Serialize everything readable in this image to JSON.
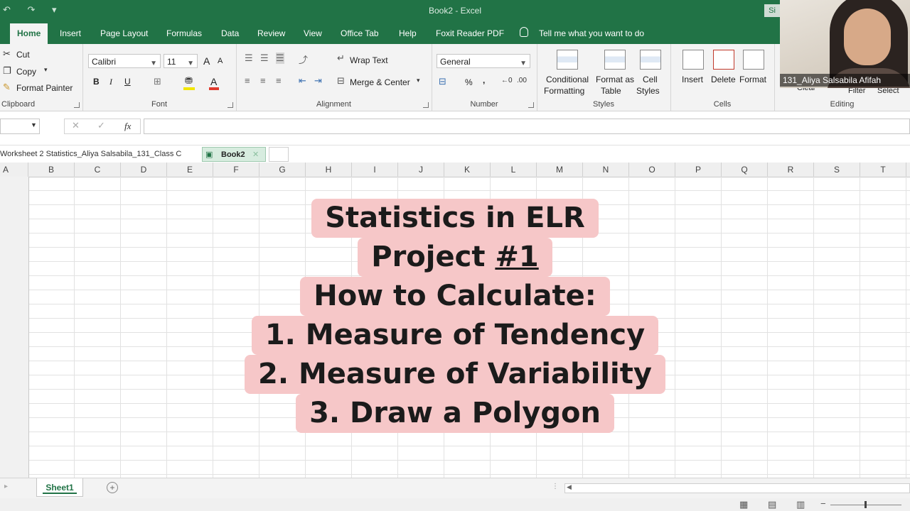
{
  "window": {
    "title": "Book2  -  Excel",
    "signin": "Si"
  },
  "ribbon_tabs": [
    "Home",
    "Insert",
    "Page Layout",
    "Formulas",
    "Data",
    "Review",
    "View",
    "Office Tab",
    "Help",
    "Foxit Reader PDF"
  ],
  "tell_me": "Tell me what you want to do",
  "clipboard": {
    "label": "Clipboard",
    "cut": "Cut",
    "copy": "Copy",
    "format_painter": "Format Painter"
  },
  "font": {
    "label": "Font",
    "name": "Calibri",
    "size": "11",
    "grow": "A",
    "shrink": "A",
    "bold": "B",
    "italic": "I",
    "underline": "U",
    "color_letter": "A",
    "font_color": "#e03a2e",
    "fill_color": "#f2e600"
  },
  "alignment": {
    "label": "Alignment",
    "wrap_text": "Wrap Text",
    "merge_center": "Merge & Center"
  },
  "number": {
    "label": "Number",
    "format": "General",
    "percent": "%",
    "comma": ","
  },
  "styles": {
    "label": "Styles",
    "conditional_1": "Conditional",
    "conditional_2": "Formatting",
    "format_table_1": "Format as",
    "format_table_2": "Table",
    "cell_styles_1": "Cell",
    "cell_styles_2": "Styles"
  },
  "cells": {
    "label": "Cells",
    "insert": "Insert",
    "delete": "Delete",
    "format": "Format"
  },
  "editing": {
    "label": "Editing",
    "clear": "Clear",
    "filter": "Filter",
    "select": "Select"
  },
  "formula_bar": {
    "fx": "fx"
  },
  "workbook_tabs": [
    "Worksheet 2 Statistics_Aliya Salsabila_131_Class C",
    "Book2"
  ],
  "columns": [
    "A",
    "B",
    "C",
    "D",
    "E",
    "F",
    "G",
    "H",
    "I",
    "J",
    "K",
    "L",
    "M",
    "N",
    "O",
    "P",
    "Q",
    "R",
    "S",
    "T"
  ],
  "overlay": {
    "line1": "Statistics in ELR",
    "line2_a": "Project ",
    "line2_b": "#1",
    "line3": "How to Calculate:",
    "line4": "1. Measure of Tendency",
    "line5": "2. Measure of Variability",
    "line6": "3. Draw a Polygon",
    "bg_color": "#f6c7c8"
  },
  "sheet_tab": "Sheet1",
  "webcam": {
    "name": "131_Aliya Salsabila Afifah"
  }
}
